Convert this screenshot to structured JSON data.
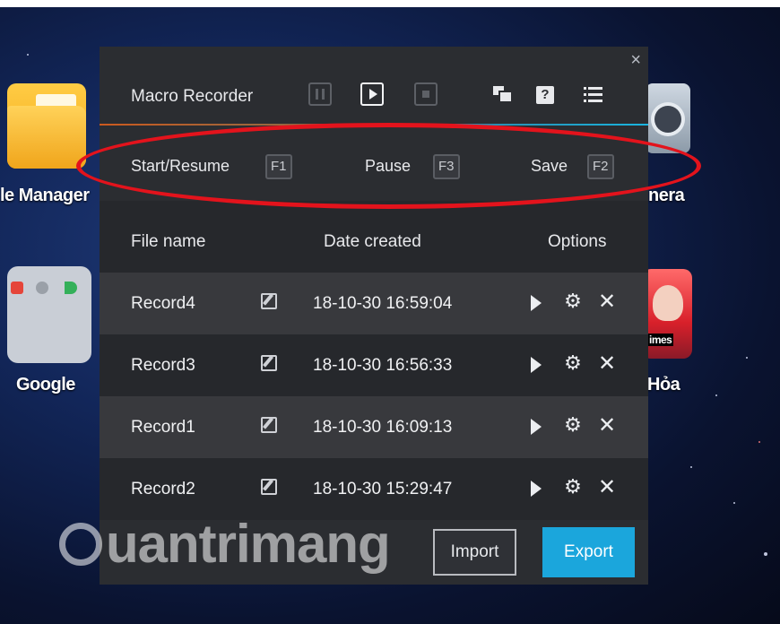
{
  "desktop": {
    "left_app_1": "le Manager",
    "left_app_2": "Google",
    "right_app_1": "nera",
    "right_app_2": "Hỏa",
    "game_badge": "imes"
  },
  "window": {
    "title": "Macro Recorder",
    "close_glyph": "×",
    "help_glyph": "?",
    "toolbar_icons": [
      "pause-icon",
      "play-icon",
      "stop-icon",
      "windows-icon",
      "help-icon",
      "list-menu-icon"
    ]
  },
  "hotkeys": {
    "start_label": "Start/Resume",
    "start_key": "F1",
    "pause_label": "Pause",
    "pause_key": "F3",
    "save_label": "Save",
    "save_key": "F2"
  },
  "table": {
    "headers": {
      "file_name": "File name",
      "date_created": "Date created",
      "options": "Options"
    },
    "rows": [
      {
        "name": "Record4",
        "date": "18-10-30 16:59:04"
      },
      {
        "name": "Record3",
        "date": "18-10-30 16:56:33"
      },
      {
        "name": "Record1",
        "date": "18-10-30 16:09:13"
      },
      {
        "name": "Record2",
        "date": "18-10-30 15:29:47"
      }
    ],
    "row_option_icons": [
      "play-icon",
      "gear-icon",
      "delete-icon"
    ]
  },
  "buttons": {
    "import": "Import",
    "export": "Export"
  },
  "watermark": {
    "text": "uantrimang"
  },
  "colors": {
    "accent_blue": "#1ba6dc",
    "highlight_red": "#e3131c",
    "panel_bg": "#2b2d31"
  }
}
